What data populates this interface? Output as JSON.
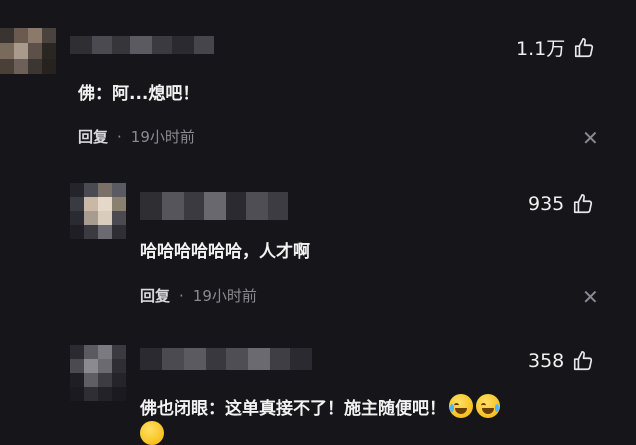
{
  "comments": [
    {
      "likes": "1.1万",
      "text": "佛：阿...熄吧！",
      "reply_label": "回复",
      "separator": "·",
      "time": "19小时前",
      "close_symbol": "✕"
    },
    {
      "likes": "935",
      "text": "哈哈哈哈哈哈，人才啊",
      "reply_label": "回复",
      "separator": "·",
      "time": "19小时前",
      "close_symbol": "✕"
    },
    {
      "likes": "358",
      "text": "佛也闭眼：这单真接不了！施主随便吧！",
      "emoji_icon": "laughing-tears-emoji"
    }
  ],
  "colors": {
    "background": "#16161a",
    "text": "#f2f2f2",
    "muted": "#8a8a90"
  }
}
